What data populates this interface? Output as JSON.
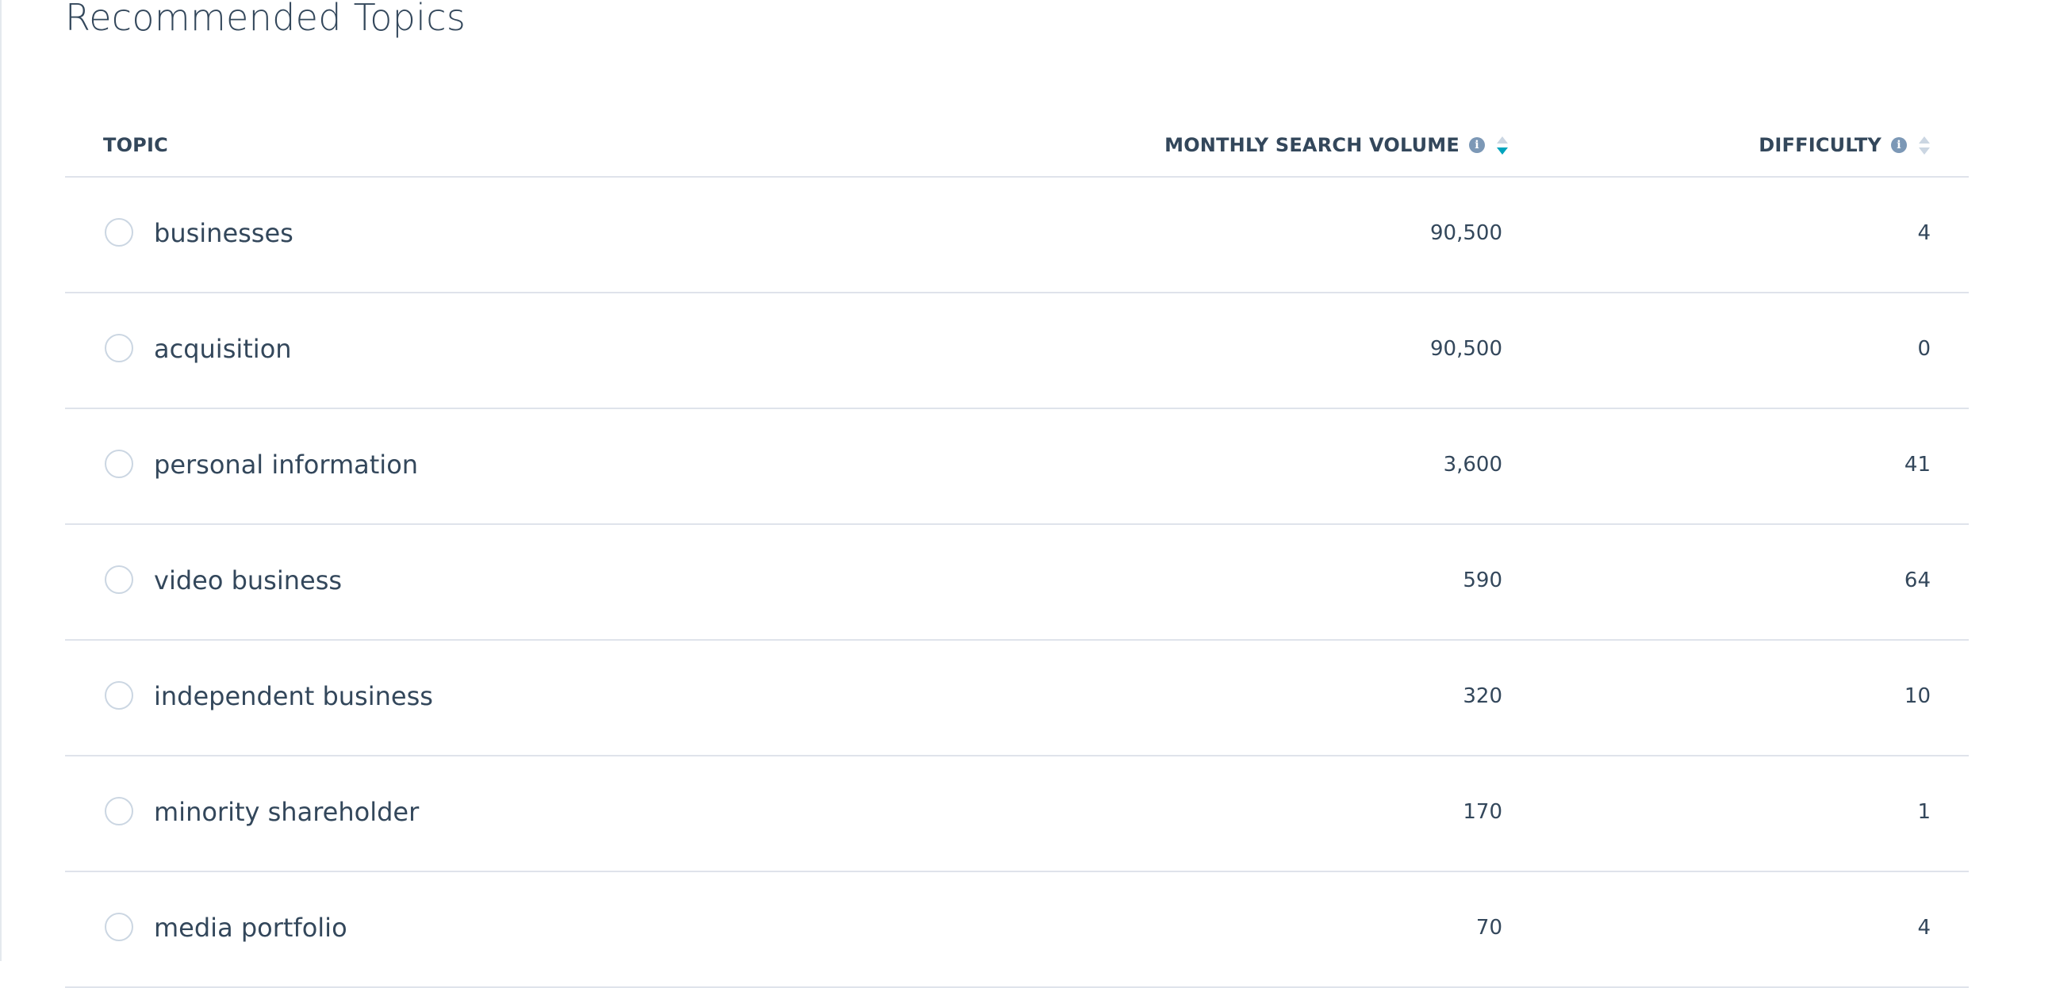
{
  "page": {
    "title": "Recommended Topics"
  },
  "table": {
    "columns": {
      "topic": "TOPIC",
      "volume": "MONTHLY SEARCH VOLUME",
      "difficulty": "DIFFICULTY"
    },
    "sort": {
      "column": "volume",
      "direction": "descending"
    },
    "rows": [
      {
        "topic": "businesses",
        "volume": "90,500",
        "difficulty": "4"
      },
      {
        "topic": "acquisition",
        "volume": "90,500",
        "difficulty": "0"
      },
      {
        "topic": "personal information",
        "volume": "3,600",
        "difficulty": "41"
      },
      {
        "topic": "video business",
        "volume": "590",
        "difficulty": "64"
      },
      {
        "topic": "independent business",
        "volume": "320",
        "difficulty": "10"
      },
      {
        "topic": "minority shareholder",
        "volume": "170",
        "difficulty": "1"
      },
      {
        "topic": "media portfolio",
        "volume": "70",
        "difficulty": "4"
      }
    ]
  },
  "icons": {
    "info": "info-icon",
    "sort": "sort-icon",
    "row_select": "radio-circle"
  },
  "colors": {
    "text": "#33475b",
    "sort_active": "#00a4bd",
    "sort_inactive": "#cbd6e2",
    "info_icon": "#7c98b6",
    "divider": "#dfe3eb"
  }
}
